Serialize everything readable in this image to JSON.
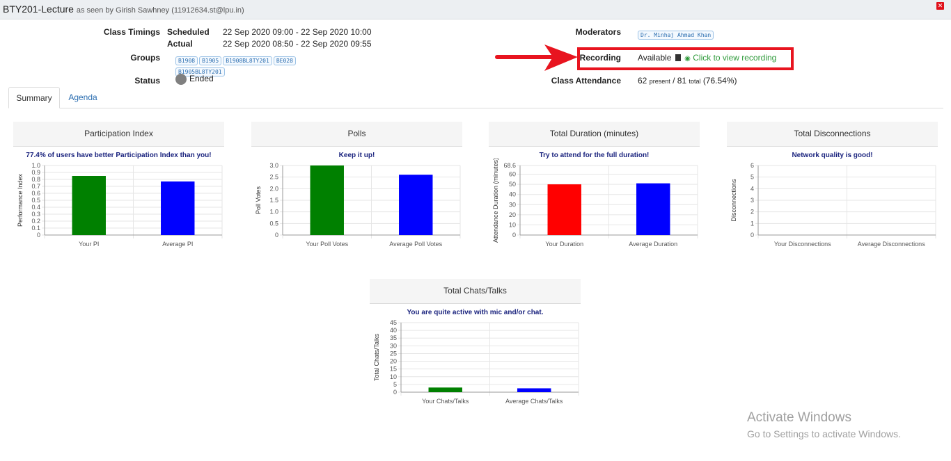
{
  "window": {
    "title": "BTY201-Lecture",
    "subtitle": "as seen by Girish Sawhney (11912634.st@lpu.in)",
    "close_label": "✕"
  },
  "info": {
    "class_timings_label": "Class Timings",
    "scheduled_label": "Scheduled",
    "scheduled_value": "22 Sep 2020 09:00 - 22 Sep 2020 10:00",
    "actual_label": "Actual",
    "actual_value": "22 Sep 2020 08:50 - 22 Sep 2020 09:55",
    "groups_label": "Groups",
    "groups": [
      "B1908",
      "B1905",
      "B1908BL8TY201",
      "BE028",
      "B1905BL8TY201"
    ],
    "status_label": "Status",
    "status_value": "Ended",
    "moderators_label": "Moderators",
    "moderators": [
      "Dr. Minhaj Ahmad Khan"
    ],
    "recording_label": "Recording",
    "recording_status": "Available",
    "recording_link": "Click to view recording",
    "attendance_label": "Class Attendance",
    "attendance_present": "62",
    "attendance_present_word": "present",
    "attendance_total": "81",
    "attendance_total_word": "total",
    "attendance_pct": "(76.54%)"
  },
  "tabs": [
    {
      "label": "Summary",
      "active": true
    },
    {
      "label": "Agenda",
      "active": false
    }
  ],
  "icons": {
    "copy": "copy-icon",
    "eye": "eye-icon",
    "status": "status-dot-icon",
    "arrow": "arrow-annotation"
  },
  "colors": {
    "green": "#008000",
    "blue": "#0000ff",
    "red": "#ff0000",
    "highlight": "#e8141f",
    "link_green": "#2e9a3a",
    "message": "#1a237e"
  },
  "chart_data": [
    {
      "type": "bar",
      "title": "Participation Index",
      "subtitle": "77.4% of users have better Participation Index than you!",
      "ylabel": "Performance Index",
      "categories": [
        "Your PI",
        "Average PI"
      ],
      "values": [
        0.85,
        0.77
      ],
      "colors": [
        "#008000",
        "#0000ff"
      ],
      "ylim": [
        0,
        1.0
      ],
      "yticks": [
        "0",
        "0.1",
        "0.2",
        "0.3",
        "0.4",
        "0.5",
        "0.6",
        "0.7",
        "0.8",
        "0.9",
        "1.0"
      ]
    },
    {
      "type": "bar",
      "title": "Polls",
      "subtitle": "Keep it up!",
      "ylabel": "Poll Votes",
      "categories": [
        "Your Poll Votes",
        "Average Poll Votes"
      ],
      "values": [
        3.0,
        2.6
      ],
      "colors": [
        "#008000",
        "#0000ff"
      ],
      "ylim": [
        0,
        3.0
      ],
      "yticks": [
        "0",
        "0.5",
        "1.0",
        "1.5",
        "2.0",
        "2.5",
        "3.0"
      ]
    },
    {
      "type": "bar",
      "title": "Total Duration (minutes)",
      "subtitle": "Try to attend for the full duration!",
      "ylabel": "Attendance Duration (minutes)",
      "categories": [
        "Your Duration",
        "Average Duration"
      ],
      "values": [
        50,
        51
      ],
      "colors": [
        "#ff0000",
        "#0000ff"
      ],
      "ylim": [
        0,
        68.6
      ],
      "yticks": [
        "0",
        "10",
        "20",
        "30",
        "40",
        "50",
        "60",
        "68.6"
      ]
    },
    {
      "type": "bar",
      "title": "Total Disconnections",
      "subtitle": "Network quality is good!",
      "ylabel": "Disconnections",
      "categories": [
        "Your Disconnections",
        "Average Disconnections"
      ],
      "values": [
        0,
        0
      ],
      "colors": [
        "#008000",
        "#0000ff"
      ],
      "ylim": [
        0,
        6
      ],
      "yticks": [
        "0",
        "1",
        "2",
        "3",
        "4",
        "5",
        "6"
      ]
    },
    {
      "type": "bar",
      "title": "Total Chats/Talks",
      "subtitle": "You are quite active with mic and/or chat.",
      "ylabel": "Total Chats/Talks",
      "categories": [
        "Your Chats/Talks",
        "Average Chats/Talks"
      ],
      "values": [
        3,
        2.5
      ],
      "colors": [
        "#008000",
        "#0000ff"
      ],
      "ylim": [
        0,
        45
      ],
      "yticks": [
        "0",
        "5",
        "10",
        "15",
        "20",
        "25",
        "30",
        "35",
        "40",
        "45"
      ]
    }
  ],
  "watermark": {
    "line1": "Activate Windows",
    "line2": "Go to Settings to activate Windows."
  }
}
